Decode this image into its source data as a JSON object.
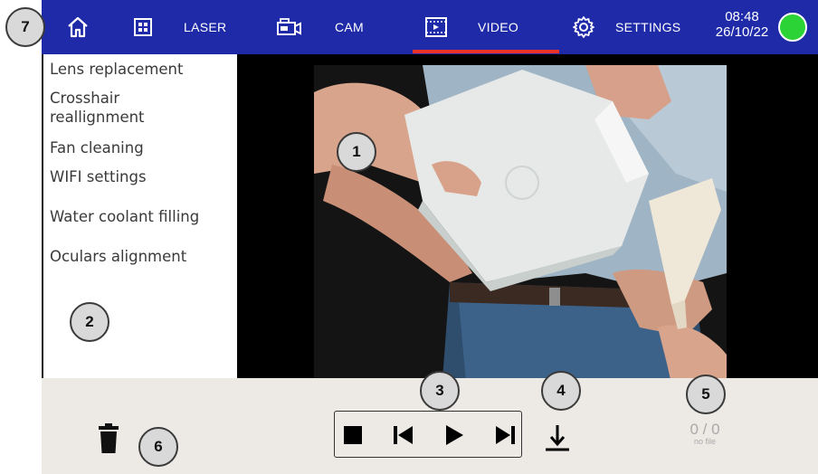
{
  "topbar": {
    "tabs": [
      {
        "label": "LASER"
      },
      {
        "label": "CAM"
      },
      {
        "label": "VIDEO",
        "active": true
      },
      {
        "label": "SETTINGS"
      }
    ],
    "time": "08:48",
    "date": "26/10/22",
    "status_color": "#2bd336",
    "bar_color": "#1e2aa8",
    "active_indicator_color": "#e8332a",
    "icons": [
      "home-icon",
      "grid-icon",
      "camera-icon",
      "film-icon",
      "gear-icon"
    ]
  },
  "sidebar": {
    "items": [
      {
        "label": "Lens replacement"
      },
      {
        "label": "Crosshair reallignment"
      },
      {
        "label": "Fan cleaning"
      },
      {
        "label": "WIFI settings"
      },
      {
        "label": "Water coolant filling"
      },
      {
        "label": "Oculars alignment"
      }
    ]
  },
  "player": {
    "controls": [
      "stop-icon",
      "previous-icon",
      "play-icon",
      "next-icon"
    ],
    "counter": "0 / 0",
    "file_status": "no file"
  },
  "callouts": [
    "1",
    "2",
    "3",
    "4",
    "5",
    "6",
    "7"
  ]
}
